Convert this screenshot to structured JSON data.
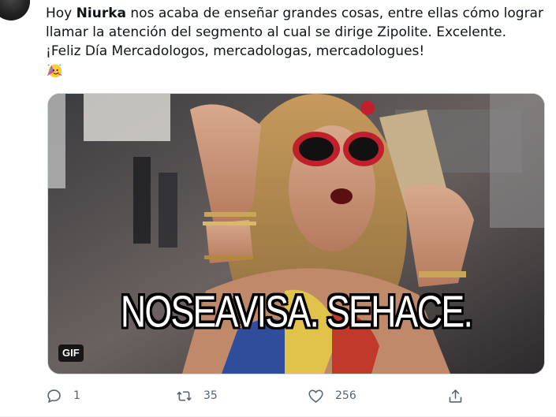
{
  "tweet": {
    "text": {
      "line1_prefix": "Hoy ",
      "line1_bold": "Niurka",
      "line1_suffix": " nos acaba de enseñar grandes cosas, entre ellas cómo lograr",
      "line2": "llamar la atención del segmento al cual se dirige Zipolite. Excelente.",
      "line3": "¡Feliz Día Mercadologos, mercadologas, mercadologues!",
      "emoji": "partying-face-emoji"
    },
    "media": {
      "caption": "NOSEAVISA. SEHACE.",
      "badge": "GIF"
    },
    "actions": {
      "reply": {
        "icon": "reply-icon",
        "count": "1"
      },
      "retweet": {
        "icon": "retweet-icon",
        "count": "35"
      },
      "like": {
        "icon": "heart-icon",
        "count": "256"
      },
      "share": {
        "icon": "share-icon"
      }
    }
  }
}
